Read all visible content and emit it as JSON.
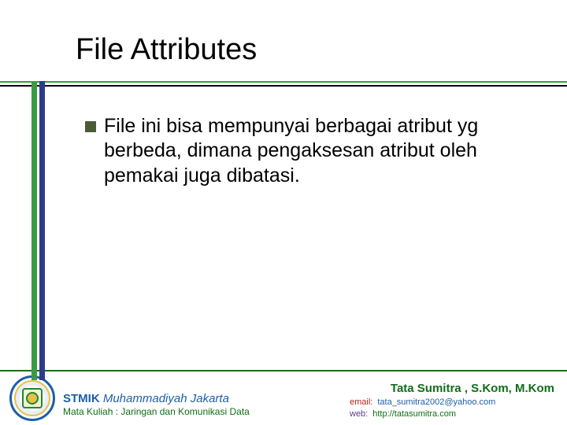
{
  "title": "File Attributes",
  "content": {
    "bullets": [
      "File ini bisa mempunyai berbagai atribut yg berbeda, dimana pengaksesan atribut oleh pemakai juga dibatasi."
    ]
  },
  "footer": {
    "org_strong": "STMIK",
    "org_em": "Muhammadiyah Jakarta",
    "course_label": "Mata Kuliah :",
    "course_value": "Jaringan dan Komunikasi Data",
    "author": "Tata Sumitra , S.Kom, M.Kom",
    "email_label": "email:",
    "email_value": "tata_sumitra2002@yahoo.com",
    "web_label": "web:",
    "web_value": "http://tatasumitra.com"
  }
}
